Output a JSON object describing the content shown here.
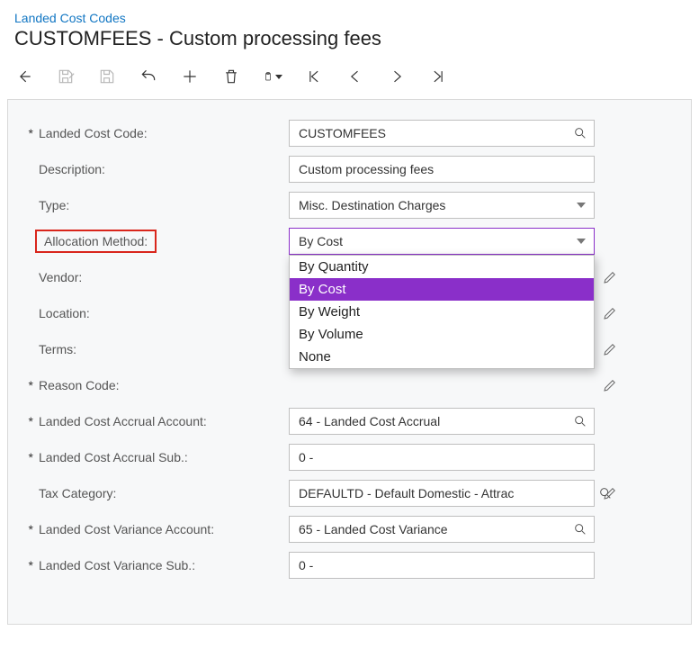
{
  "breadcrumb": "Landed Cost Codes",
  "title": "CUSTOMFEES - Custom processing fees",
  "toolbar_icons": [
    "back",
    "save-and-close",
    "save",
    "undo",
    "add",
    "delete",
    "clipboard",
    "first",
    "prev",
    "next",
    "last"
  ],
  "fields": {
    "landed_cost_code": {
      "label": "Landed Cost Code:",
      "value": "CUSTOMFEES",
      "required": true,
      "kind": "lookup"
    },
    "description": {
      "label": "Description:",
      "value": "Custom processing fees",
      "required": false,
      "kind": "text"
    },
    "type": {
      "label": "Type:",
      "value": "Misc. Destination Charges",
      "required": false,
      "kind": "select"
    },
    "allocation_method": {
      "label": "Allocation Method:",
      "value": "By Cost",
      "required": false,
      "kind": "select",
      "open": true,
      "options": [
        "By Quantity",
        "By Cost",
        "By Weight",
        "By Volume",
        "None"
      ],
      "selected": "By Cost"
    },
    "vendor": {
      "label": "Vendor:",
      "value": "",
      "required": false,
      "kind": "lookup",
      "pencil": true
    },
    "location": {
      "label": "Location:",
      "value": "",
      "required": false,
      "kind": "lookup",
      "pencil": true
    },
    "terms": {
      "label": "Terms:",
      "value": "",
      "required": false,
      "kind": "lookup",
      "pencil": true
    },
    "reason_code": {
      "label": "Reason Code:",
      "value": "",
      "required": true,
      "kind": "lookup",
      "pencil": true
    },
    "accrual_account": {
      "label": "Landed Cost Accrual Account:",
      "value": "64 - Landed Cost Accrual",
      "required": true,
      "kind": "lookup"
    },
    "accrual_sub": {
      "label": "Landed Cost Accrual Sub.:",
      "value": "0 -",
      "required": true,
      "kind": "lookup"
    },
    "tax_category": {
      "label": "Tax Category:",
      "value": "DEFAULTD - Default Domestic - Attrac",
      "required": false,
      "kind": "lookup",
      "pencil": true
    },
    "variance_account": {
      "label": "Landed Cost Variance Account:",
      "value": "65 - Landed Cost Variance",
      "required": true,
      "kind": "lookup"
    },
    "variance_sub": {
      "label": "Landed Cost Variance Sub.:",
      "value": "0 -",
      "required": true,
      "kind": "lookup"
    }
  }
}
